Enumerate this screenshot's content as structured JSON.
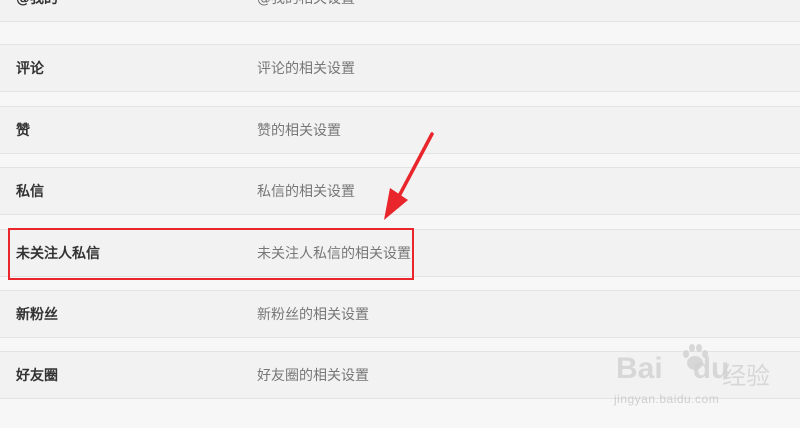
{
  "settings_rows": [
    {
      "name": "@我的",
      "description": "@我的相关设置"
    },
    {
      "name": "评论",
      "description": "评论的相关设置"
    },
    {
      "name": "赞",
      "description": "赞的相关设置"
    },
    {
      "name": "私信",
      "description": "私信的相关设置"
    },
    {
      "name": "未关注人私信",
      "description": "未关注人私信的相关设置"
    },
    {
      "name": "新粉丝",
      "description": "新粉丝的相关设置"
    },
    {
      "name": "好友圈",
      "description": "好友圈的相关设置"
    }
  ],
  "annotation": {
    "highlight_color": "#e8262b",
    "highlighted_row": "未关注人私信"
  },
  "watermark": {
    "logo_text": "Bai",
    "logo_text_2": "du",
    "product_text": "经验",
    "url_text": "jingyan.baidu.com"
  }
}
